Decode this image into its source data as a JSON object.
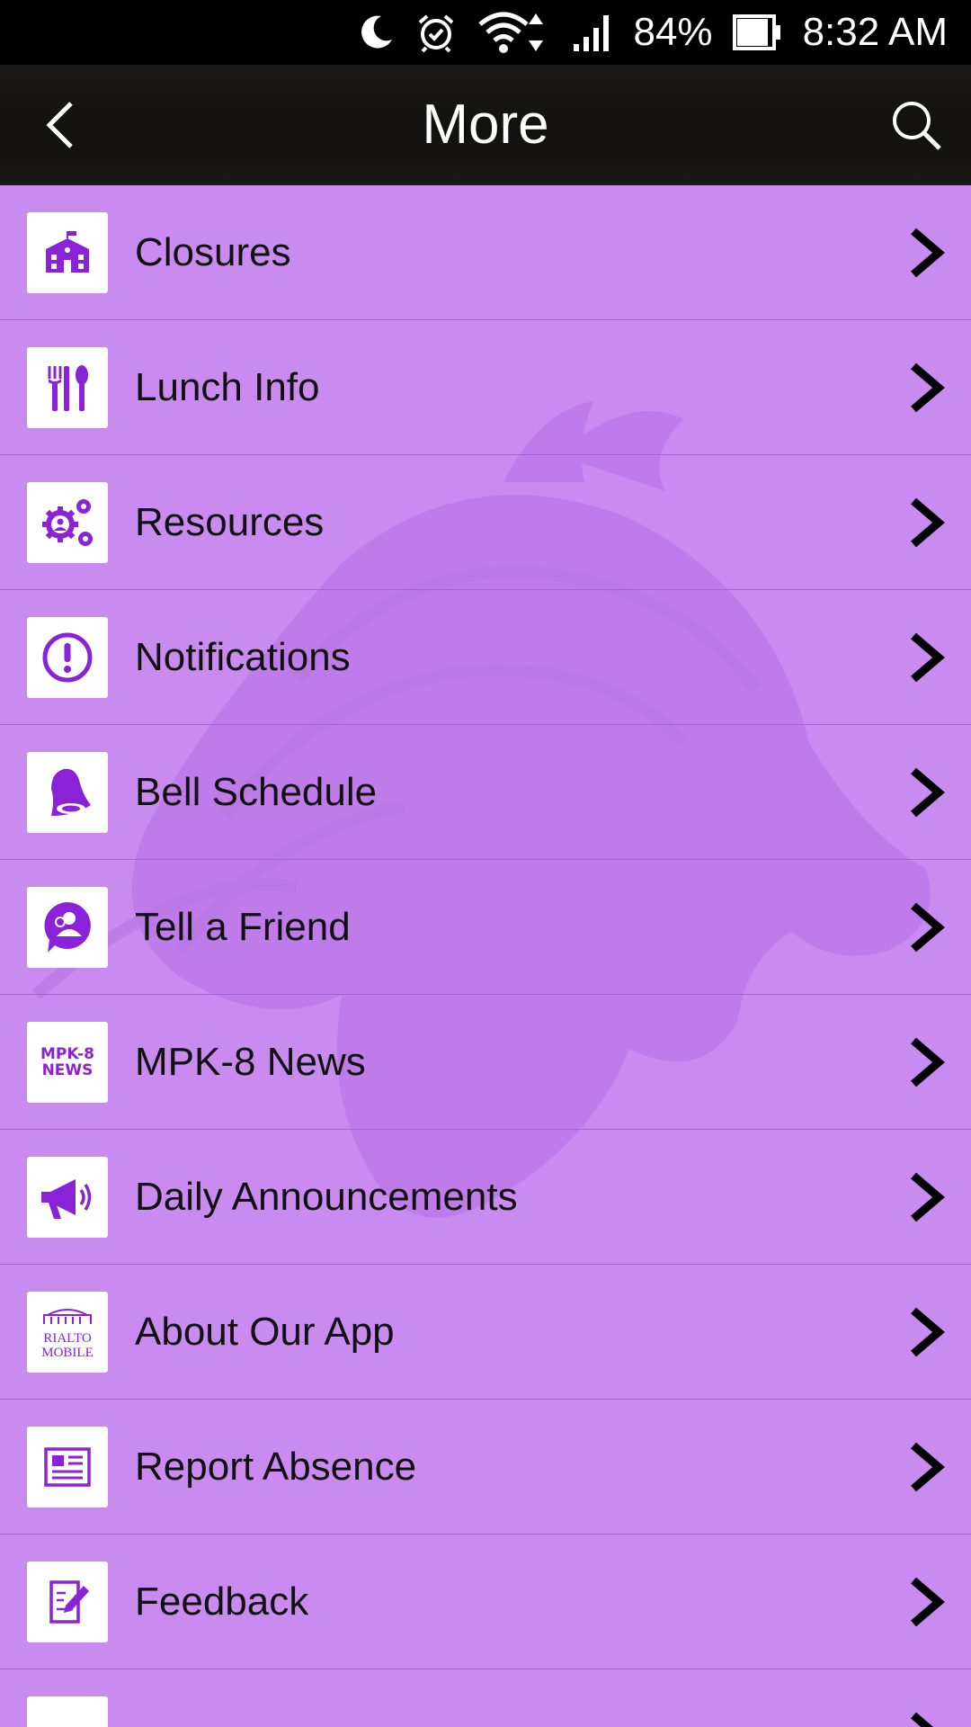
{
  "status_bar": {
    "battery": "84%",
    "time": "8:32 AM",
    "icons": [
      "moon-icon",
      "alarm-icon",
      "wifi-icon",
      "signal-icon",
      "battery-icon"
    ]
  },
  "app_bar": {
    "title": "More",
    "back_icon": "back-arrow-icon",
    "search_icon": "search-icon",
    "background": "#151412"
  },
  "theme": {
    "list_background": "#c98bf0",
    "icon_color": "#8a22d8",
    "divider": "#9a6cb9"
  },
  "menu": {
    "items": [
      {
        "label": "Closures",
        "icon": "school-icon"
      },
      {
        "label": "Lunch Info",
        "icon": "utensils-icon"
      },
      {
        "label": "Resources",
        "icon": "gears-person-icon"
      },
      {
        "label": "Notifications",
        "icon": "exclamation-icon"
      },
      {
        "label": "Bell Schedule",
        "icon": "bell-icon"
      },
      {
        "label": "Tell a Friend",
        "icon": "person-bubble-icon"
      },
      {
        "label": "MPK-8 News",
        "icon": "news-icon",
        "icon_text_1": "MPK-8",
        "icon_text_2": "NEWS"
      },
      {
        "label": "Daily Announcements",
        "icon": "megaphone-icon"
      },
      {
        "label": "About Our App",
        "icon": "rialto-mobile-icon",
        "icon_text_1": "RIALTO",
        "icon_text_2": "MOBILE"
      },
      {
        "label": "Report Absence",
        "icon": "form-icon"
      },
      {
        "label": "Feedback",
        "icon": "edit-note-icon"
      },
      {
        "label": "",
        "icon": "partial-item-icon"
      }
    ]
  }
}
